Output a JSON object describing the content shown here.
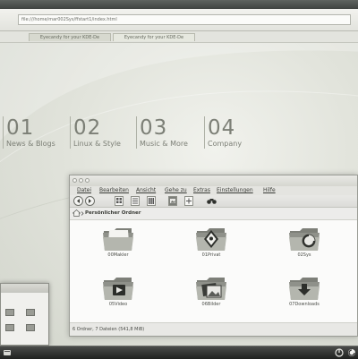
{
  "browser": {
    "url": "file:///home/mar002Sys/ffstart1/index.html",
    "tabs": [
      {
        "label": "Eyecandy for your KDE-De"
      },
      {
        "label": "Eyecandy for your KDE-De"
      }
    ]
  },
  "page": {
    "nav": [
      {
        "number": "01",
        "label": "News & Blogs"
      },
      {
        "number": "02",
        "label": "Linux & Style"
      },
      {
        "number": "03",
        "label": "Music & More"
      },
      {
        "number": "04",
        "label": "Company"
      }
    ]
  },
  "file_manager": {
    "menu": [
      "Datei",
      "Bearbeiten",
      "Ansicht",
      "Gehe zu",
      "Extras",
      "Einstellungen",
      "Hilfe"
    ],
    "path": "Persönlicher Ordner",
    "items": [
      {
        "name": "00Makler",
        "icon": "folder-icon"
      },
      {
        "name": "01Privat",
        "icon": "folder-private-icon"
      },
      {
        "name": "02Sys",
        "icon": "folder-system-icon"
      },
      {
        "name": "05Video",
        "icon": "folder-video-icon"
      },
      {
        "name": "06Bilder",
        "icon": "folder-pictures-icon"
      },
      {
        "name": "07Downloads",
        "icon": "folder-downloads-icon"
      }
    ],
    "status": "6 Ordner, 7 Dateien (541,8 MiB)"
  },
  "colors": {
    "accent": "#7c7f76",
    "taskbar": "#2b2d2b"
  }
}
